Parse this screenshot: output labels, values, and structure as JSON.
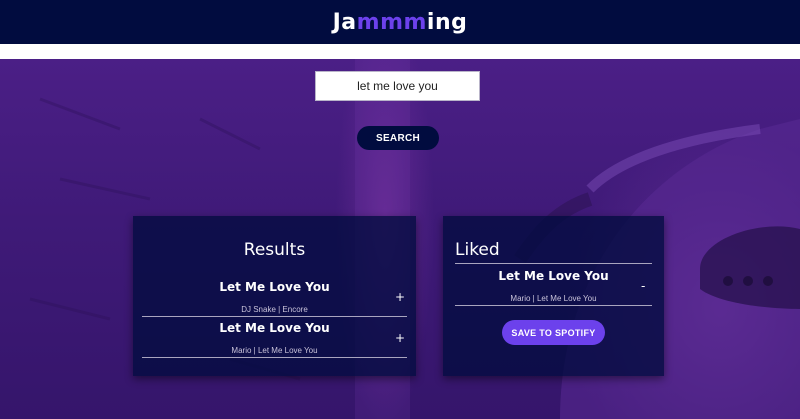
{
  "header": {
    "logo_prefix": "Ja",
    "logo_accent": "mmm",
    "logo_suffix": "ing"
  },
  "search": {
    "value": "let me love you",
    "button_label": "SEARCH"
  },
  "results": {
    "title": "Results",
    "tracks": [
      {
        "name": "Let Me Love You",
        "meta": "DJ Snake | Encore",
        "action": "+"
      },
      {
        "name": "Let Me Love You",
        "meta": "Mario | Let Me Love You",
        "action": "+"
      }
    ]
  },
  "liked": {
    "title": "Liked",
    "tracks": [
      {
        "name": "Let Me Love You",
        "meta": "Mario | Let Me Love You",
        "action": "-"
      }
    ],
    "save_label": "SAVE TO SPOTIFY"
  },
  "colors": {
    "header_bg": "#010c3f",
    "accent": "#6c41ec",
    "hero_purple": "#4b1f86"
  }
}
